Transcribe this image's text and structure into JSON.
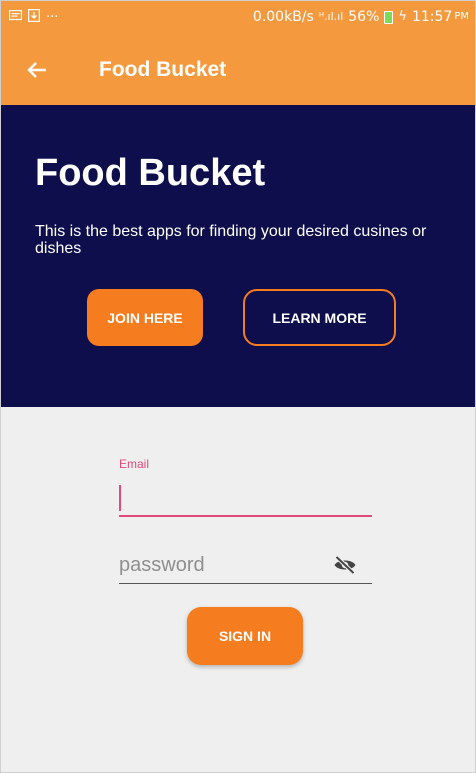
{
  "status_bar": {
    "left_icons": [
      "message-icon",
      "download-icon",
      "more-icon"
    ],
    "more_text": "···",
    "speed": "0.00kB/s",
    "signal_text": "ᴴ.ıl.ıl",
    "battery_percent": "56%",
    "charge_symbol": "ϟ",
    "time": "11:57",
    "time_suffix": "PM"
  },
  "toolbar": {
    "title": "Food Bucket",
    "background_color": "#f5993f"
  },
  "hero": {
    "title": "Food Bucket",
    "subtitle": "This is the best apps for finding your desired cusines or dishes",
    "join_label": "JOIN HERE",
    "learn_label": "LEARN MORE",
    "background_color": "#0e0e4c",
    "accent_color": "#f57c1f"
  },
  "login_form": {
    "email_label": "Email",
    "email_value": "",
    "password_placeholder": "password",
    "signin_label": "SIGN IN",
    "focus_color": "#e24a7c"
  }
}
